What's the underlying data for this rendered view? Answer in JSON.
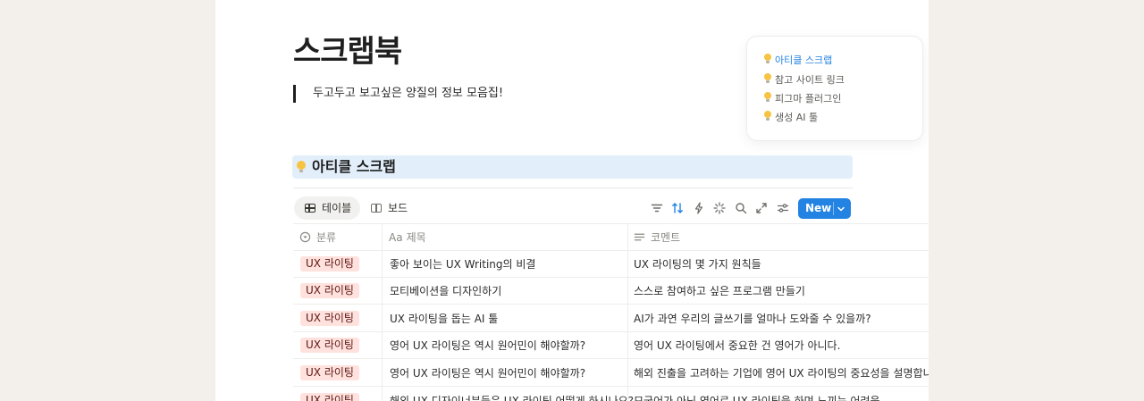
{
  "page": {
    "title": "스크랩북",
    "quote": "두고두고 보고싶은 양질의 정보 모음집!"
  },
  "toc": {
    "items": [
      {
        "label": "아티클 스크랩",
        "active": true
      },
      {
        "label": "참고 사이트 링크",
        "active": false
      },
      {
        "label": "피그마 플러그인",
        "active": false
      },
      {
        "label": "생성 AI 툴",
        "active": false
      }
    ]
  },
  "section": {
    "heading": "아티클 스크랩"
  },
  "views": {
    "table_label": "테이블",
    "board_label": "보드"
  },
  "toolbar": {
    "icons": [
      "filter-icon",
      "sort-icon",
      "automation-icon",
      "ai-icon",
      "search-icon",
      "expand-icon",
      "settings-icon"
    ],
    "new_label": "New"
  },
  "table": {
    "columns": [
      {
        "label": "분류",
        "icon": "status-icon"
      },
      {
        "label": "제목",
        "icon": "text-type-icon"
      },
      {
        "label": "코멘트",
        "icon": "lines-icon"
      }
    ],
    "rows": [
      {
        "tag": "UX 라이팅",
        "title": "좋아 보이는 UX Writing의 비결",
        "comment": "UX 라이팅의 몇 가지 원칙들"
      },
      {
        "tag": "UX 라이팅",
        "title": "모티베이션을 디자인하기",
        "comment": "스스로 참여하고 싶은 프로그램 만들기"
      },
      {
        "tag": "UX 라이팅",
        "title": "UX 라이팅을 돕는 AI 툴",
        "comment": "AI가 과연 우리의 글쓰기를 얼마나 도와줄 수 있을까?"
      },
      {
        "tag": "UX 라이팅",
        "title": "영어 UX 라이팅은 역시 원어민이 해야할까?",
        "comment": "영어 UX 라이팅에서 중요한 건 영어가 아니다."
      },
      {
        "tag": "UX 라이팅",
        "title": "영어 UX 라이팅은 역시 원어민이 해야할까?",
        "comment": "해외 진출을 고려하는 기업에 영어 UX 라이팅의 중요성을 설명합니다."
      },
      {
        "tag": "UX 라이팅",
        "title": "해외 UX 디자이너분들은 UX 라이팅 어떻게 하시나요?",
        "comment": "모국어가 아닌 영어로 UX 라이팅을 하며 느끼는 어려움"
      }
    ]
  },
  "colors": {
    "accent": "#2383e2",
    "tag_bg": "#ffe2dd",
    "tag_text": "#5d1715",
    "heading_bg": "#e2effb"
  }
}
